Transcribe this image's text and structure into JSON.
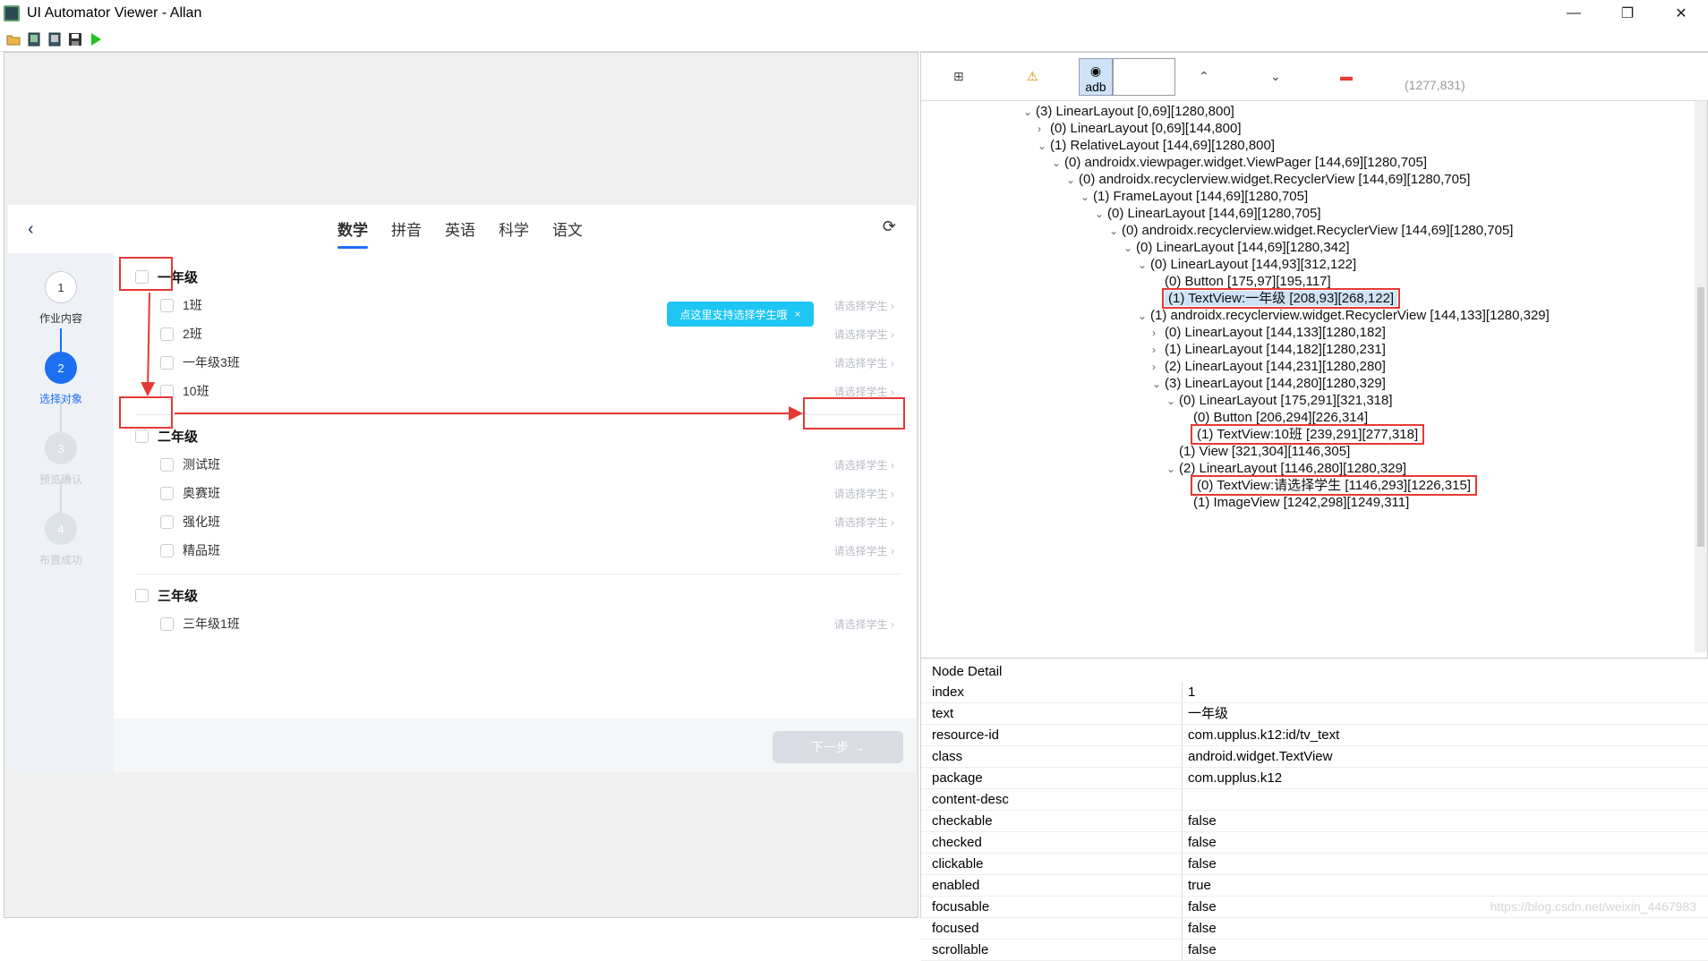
{
  "window": {
    "title": "UI Automator Viewer - Allan",
    "min": "—",
    "max": "❐",
    "close": "✕"
  },
  "app": {
    "tabs": [
      "数学",
      "拼音",
      "英语",
      "科学",
      "语文"
    ],
    "steps": [
      {
        "num": "1",
        "label": "作业内容",
        "state": "done"
      },
      {
        "num": "2",
        "label": "选择对象",
        "state": "current"
      },
      {
        "num": "3",
        "label": "预览确认",
        "state": "todo"
      },
      {
        "num": "4",
        "label": "布置成功",
        "state": "todo"
      }
    ],
    "grades": [
      {
        "name": "一年级",
        "classes": [
          "1班",
          "2班",
          "一年级3班",
          "10班"
        ]
      },
      {
        "name": "二年级",
        "classes": [
          "测试班",
          "奥赛班",
          "强化班",
          "精品班"
        ]
      },
      {
        "name": "三年级",
        "classes": [
          "三年级1班"
        ]
      }
    ],
    "pick_label": "请选择学生",
    "tip_text": "点这里支持选择学生哦",
    "tip_close": "×",
    "next_button": "下一步 →"
  },
  "viewer": {
    "adb_label": "adb",
    "coords": "(1277,831)",
    "tree": [
      {
        "d": 0,
        "t": "v",
        "text": "(3) LinearLayout [0,69][1280,800]"
      },
      {
        "d": 1,
        "t": ">",
        "text": "(0) LinearLayout [0,69][144,800]"
      },
      {
        "d": 1,
        "t": "v",
        "text": "(1) RelativeLayout [144,69][1280,800]"
      },
      {
        "d": 2,
        "t": "v",
        "text": "(0) androidx.viewpager.widget.ViewPager [144,69][1280,705]"
      },
      {
        "d": 3,
        "t": "v",
        "text": "(0) androidx.recyclerview.widget.RecyclerView [144,69][1280,705]"
      },
      {
        "d": 4,
        "t": "v",
        "text": "(1) FrameLayout [144,69][1280,705]"
      },
      {
        "d": 5,
        "t": "v",
        "text": "(0) LinearLayout [144,69][1280,705]"
      },
      {
        "d": 6,
        "t": "v",
        "text": "(0) androidx.recyclerview.widget.RecyclerView [144,69][1280,705]"
      },
      {
        "d": 7,
        "t": "v",
        "text": "(0) LinearLayout [144,69][1280,342]"
      },
      {
        "d": 8,
        "t": "v",
        "text": "(0) LinearLayout [144,93][312,122]"
      },
      {
        "d": 9,
        "t": "",
        "text": "(0) Button [175,97][195,117]"
      },
      {
        "d": 9,
        "t": "",
        "text": "(1) TextView:一年级 [208,93][268,122]"
      },
      {
        "d": 8,
        "t": "v",
        "text": "(1) androidx.recyclerview.widget.RecyclerView [144,133][1280,329]"
      },
      {
        "d": 9,
        "t": ">",
        "text": "(0) LinearLayout [144,133][1280,182]"
      },
      {
        "d": 9,
        "t": ">",
        "text": "(1) LinearLayout [144,182][1280,231]"
      },
      {
        "d": 9,
        "t": ">",
        "text": "(2) LinearLayout [144,231][1280,280]"
      },
      {
        "d": 9,
        "t": "v",
        "text": "(3) LinearLayout [144,280][1280,329]"
      },
      {
        "d": 10,
        "t": "v",
        "text": "(0) LinearLayout [175,291][321,318]"
      },
      {
        "d": 11,
        "t": "",
        "text": "(0) Button [206,294][226,314]"
      },
      {
        "d": 11,
        "t": "",
        "text": "(1) TextView:10班 [239,291][277,318]"
      },
      {
        "d": 10,
        "t": "",
        "text": "(1) View [321,304][1146,305]"
      },
      {
        "d": 10,
        "t": "v",
        "text": "(2) LinearLayout [1146,280][1280,329]"
      },
      {
        "d": 11,
        "t": "",
        "text": "(0) TextView:请选择学生 [1146,293][1226,315]"
      },
      {
        "d": 11,
        "t": "",
        "text": "(1) ImageView [1242,298][1249,311]"
      }
    ],
    "detail_title": "Node Detail",
    "detail": [
      [
        "index",
        "1"
      ],
      [
        "text",
        "一年级"
      ],
      [
        "resource-id",
        "com.upplus.k12:id/tv_text"
      ],
      [
        "class",
        "android.widget.TextView"
      ],
      [
        "package",
        "com.upplus.k12"
      ],
      [
        "content-desc",
        ""
      ],
      [
        "checkable",
        "false"
      ],
      [
        "checked",
        "false"
      ],
      [
        "clickable",
        "false"
      ],
      [
        "enabled",
        "true"
      ],
      [
        "focusable",
        "false"
      ],
      [
        "focused",
        "false"
      ],
      [
        "scrollable",
        "false"
      ]
    ],
    "watermark": "https://blog.csdn.net/weixin_4467983"
  },
  "colors": {
    "accent": "#1d6ff2",
    "highlight": "#e53935",
    "tip": "#1ec6f4"
  }
}
